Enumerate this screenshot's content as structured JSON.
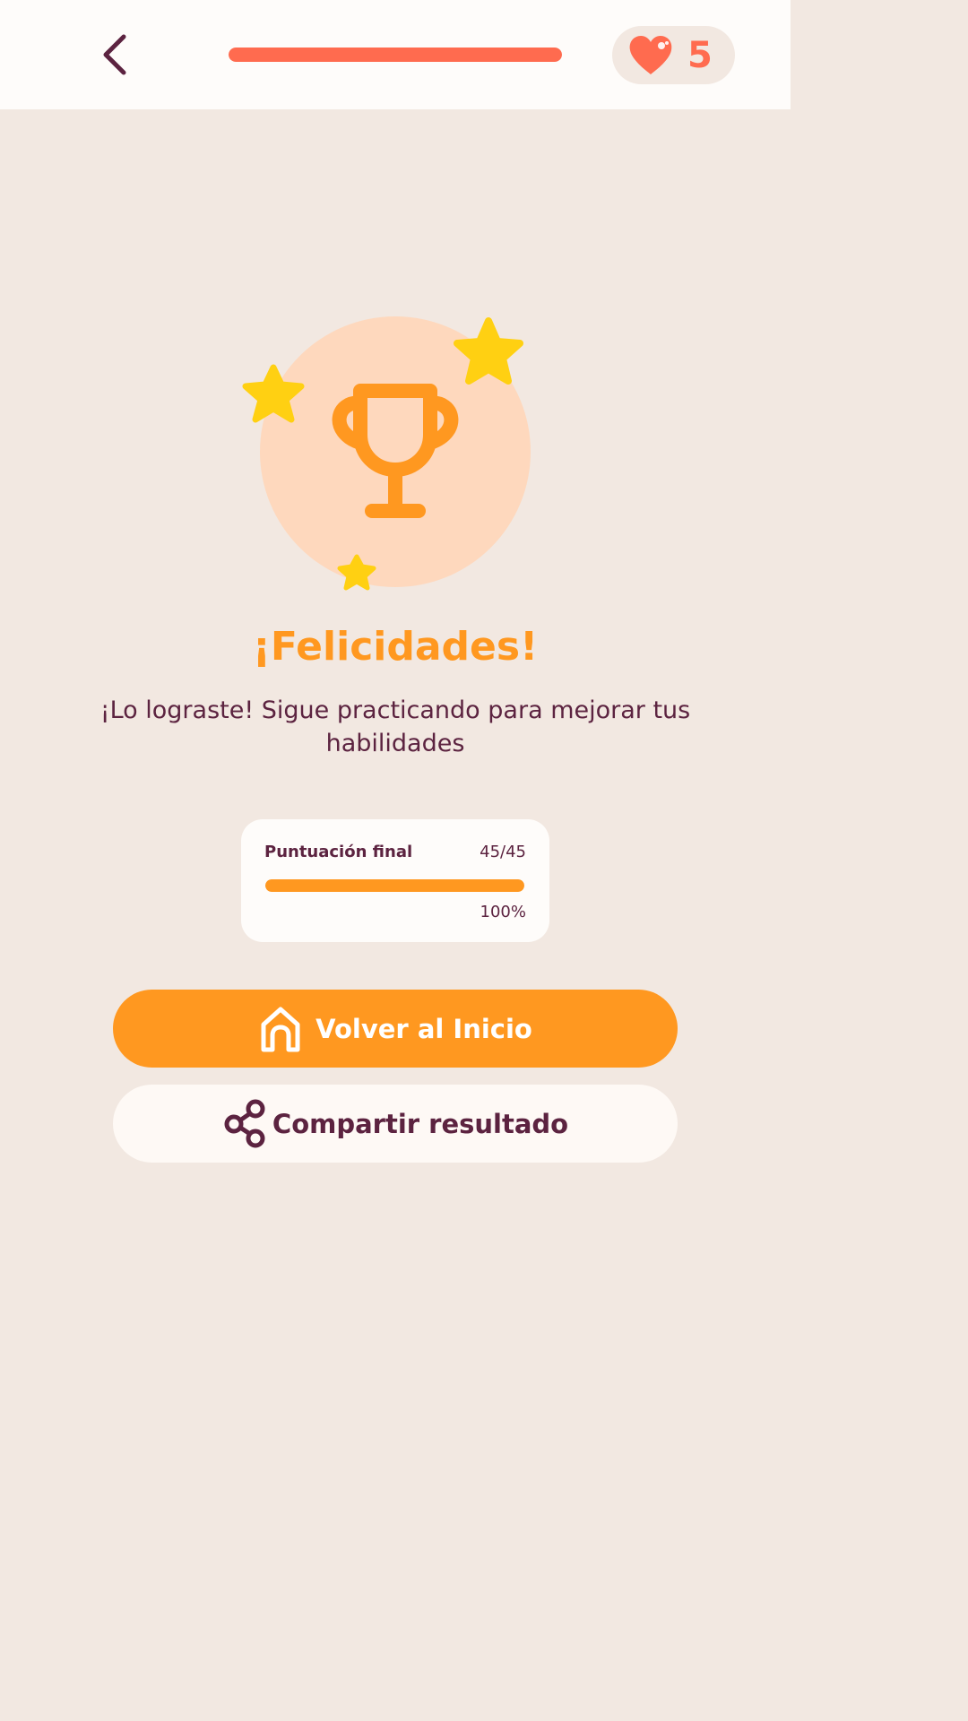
{
  "header": {
    "back_icon": "chevron-left-icon",
    "lesson_progress": 1.0,
    "lives": {
      "icon": "heart-icon",
      "count": "5"
    }
  },
  "hero": {
    "trophy_icon": "trophy-icon",
    "star_icon": "star-icon"
  },
  "result": {
    "title": "¡Felicidades!",
    "message": "¡Lo lograste! Sigue practicando para mejorar tus habilidades"
  },
  "score": {
    "label": "Puntuación final",
    "value": "45/45",
    "percent_text": "100%",
    "fraction": 1.0
  },
  "actions": {
    "home_label": "Volver al Inicio",
    "home_icon": "home-icon",
    "share_label": "Compartir resultado",
    "share_icon": "share-icon"
  },
  "colors": {
    "background": "#F2E8E1",
    "surface": "#FEFCFA",
    "accent_orange": "#FF9820",
    "accent_coral": "#FF6B4F",
    "star_yellow": "#FFD012",
    "trophy_circle": "#FED8BD",
    "text_dark": "#5C2340"
  }
}
